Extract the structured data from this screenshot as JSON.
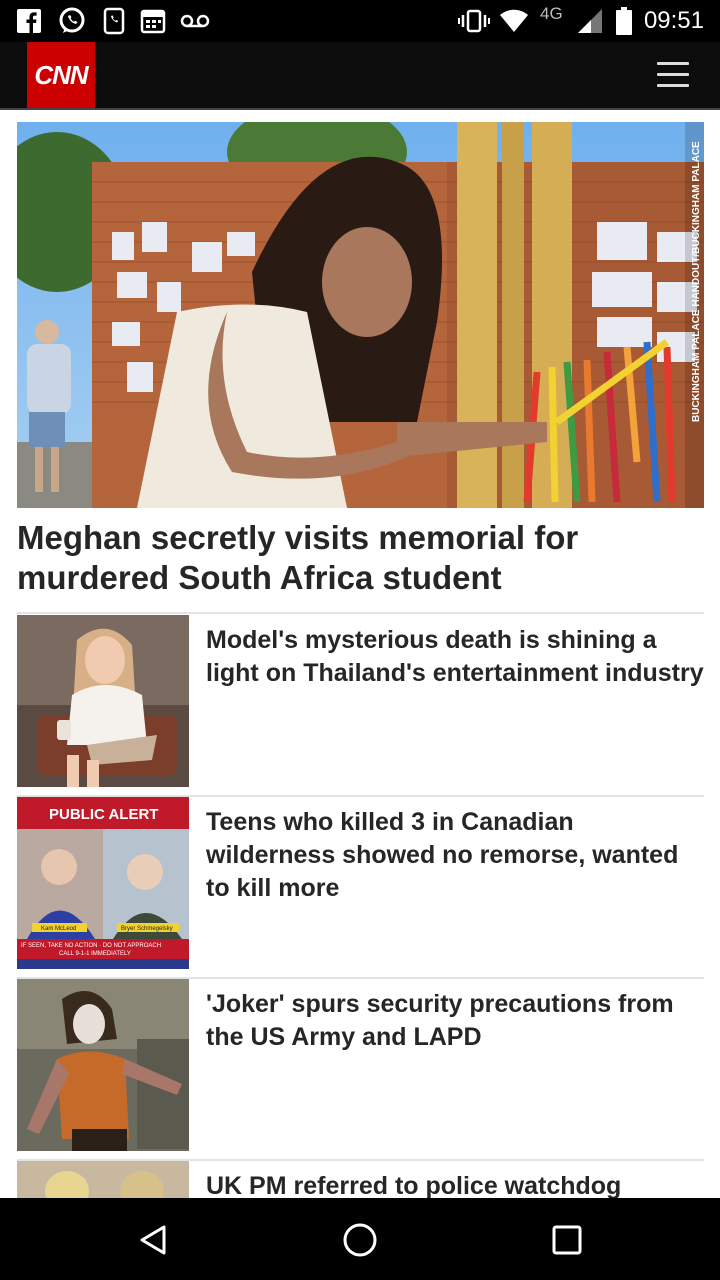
{
  "status_bar": {
    "time": "09:51",
    "network": "4G",
    "left_icons": [
      "facebook-icon",
      "whatsapp-icon",
      "phone-alt-icon",
      "calendar-icon",
      "voicemail-icon"
    ],
    "right_icons": [
      "vibrate-icon",
      "wifi-icon",
      "signal-icon",
      "battery-icon"
    ]
  },
  "header": {
    "logo_text": "CNN",
    "logo_color": "#cc0000",
    "menu_icon": "hamburger-menu-icon"
  },
  "hero": {
    "credit": "BUCKINGHAM PALACE HANDOUT/BUCKINGHAM PALACE",
    "title": "Meghan secretly visits memorial for murdered South Africa student"
  },
  "stories": [
    {
      "title": "Model's mysterious death is shining a light on Thailand's entertainment industry"
    },
    {
      "title": "Teens who killed 3 in Canadian wilderness showed no remorse, wanted to kill more",
      "thumb_banner": "PUBLIC ALERT",
      "thumb_name_left": "Kam McLeod",
      "thumb_name_right": "Bryer Schmegelsky",
      "thumb_footer_1": "IF SEEN, TAKE NO ACTION · DO NOT APPROACH",
      "thumb_footer_2": "CALL 9-1-1 IMMEDIATELY"
    },
    {
      "title": "'Joker' spurs security precautions from the US Army and LAPD"
    },
    {
      "title": "UK PM referred to police watchdog"
    }
  ],
  "nav_bar": {
    "back_icon": "back-triangle-icon",
    "home_icon": "home-circle-icon",
    "recents_icon": "recents-square-icon"
  }
}
